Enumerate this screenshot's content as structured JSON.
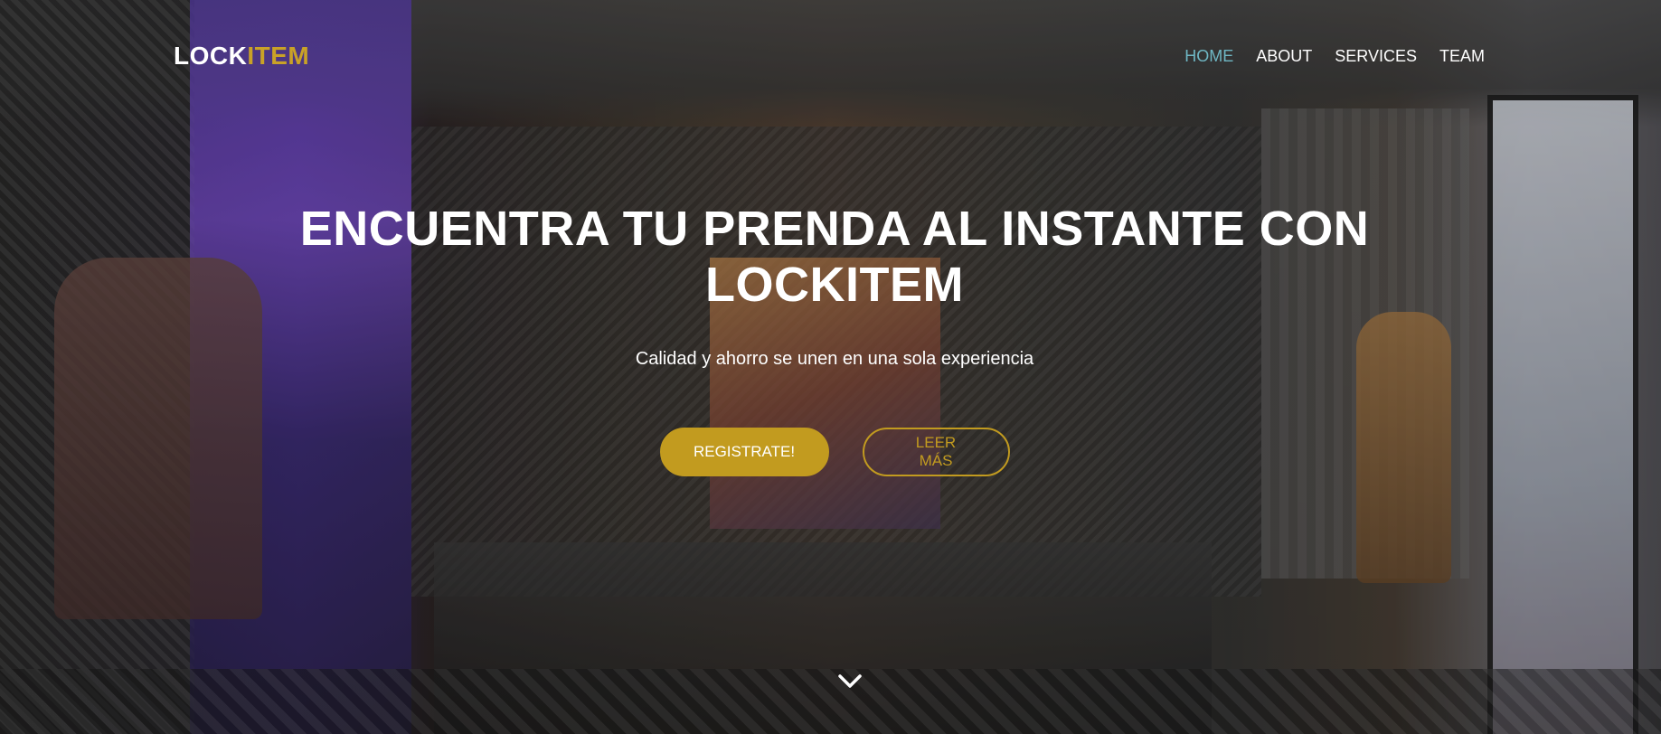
{
  "brand": {
    "logo_part1": "LOCK",
    "logo_part2": "ITEM",
    "accent_color": "#c29b1f"
  },
  "nav": {
    "items": [
      {
        "label": "HOME",
        "active": true
      },
      {
        "label": "ABOUT",
        "active": false
      },
      {
        "label": "SERVICES",
        "active": false
      },
      {
        "label": "TEAM",
        "active": false
      }
    ],
    "active_color": "#6fb7c4"
  },
  "hero": {
    "title": "ENCUENTRA TU PRENDA AL INSTANTE CON LOCKITEM",
    "subtitle": "Calidad y ahorro se unen en una sola experiencia",
    "primary_button": "REGISTRATE!",
    "secondary_button": "LEER MÁS",
    "scroll_icon": "chevron-down-icon"
  }
}
